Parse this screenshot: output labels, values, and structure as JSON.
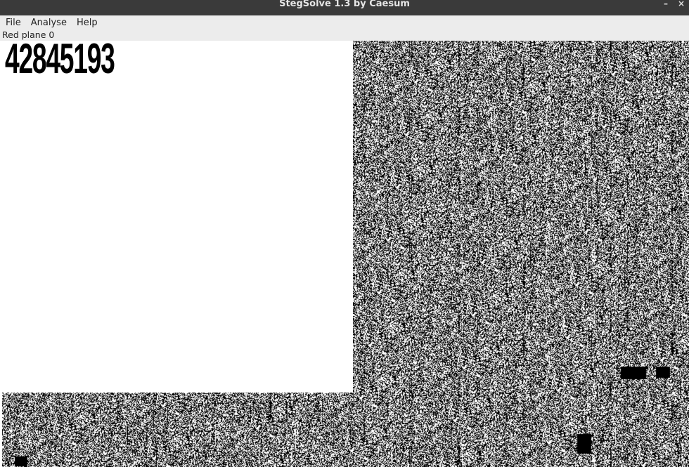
{
  "window": {
    "title": "StegSolve 1.3 by Caesum",
    "minimize_glyph": "–",
    "close_glyph": "×"
  },
  "menu": [
    {
      "label": "File"
    },
    {
      "label": "Analyse"
    },
    {
      "label": "Help"
    }
  ],
  "status": {
    "plane_label": "Red plane 0"
  },
  "image": {
    "hidden_text": "42845193",
    "foreground_color": "#000000",
    "background_color": "#ffffff"
  }
}
